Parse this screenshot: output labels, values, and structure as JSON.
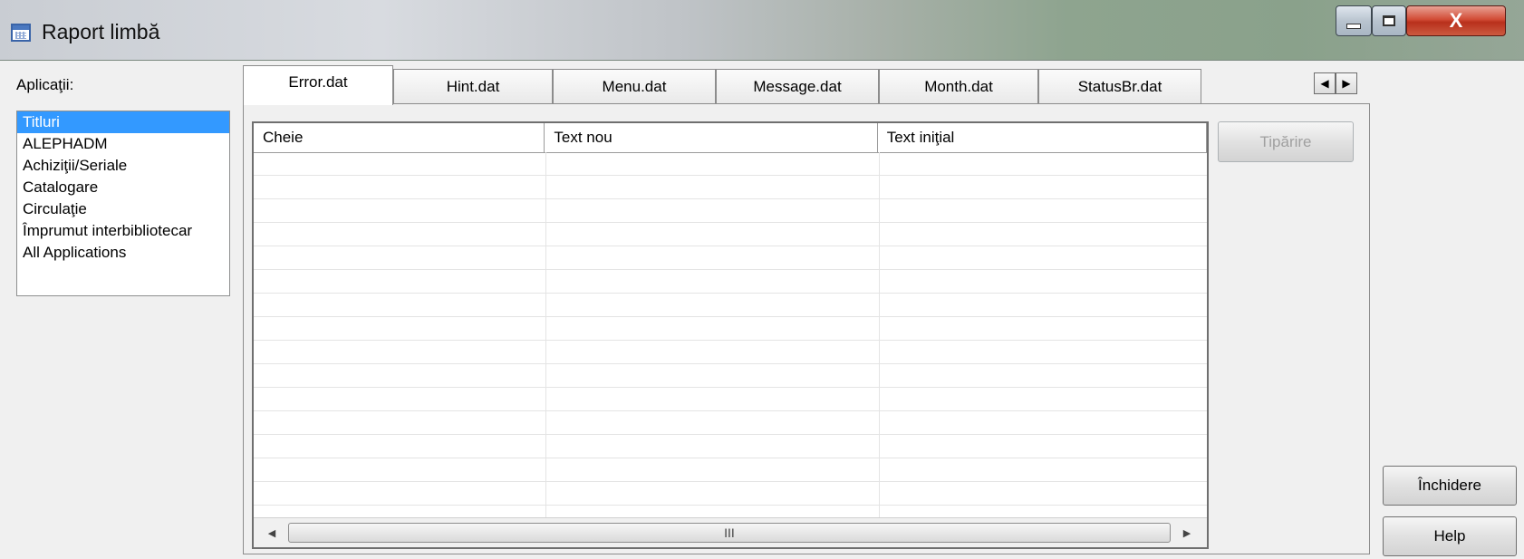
{
  "window": {
    "title": "Raport limbă",
    "close_glyph": "X"
  },
  "apps": {
    "label": "Aplicaţii:",
    "items": [
      {
        "label": "Titluri",
        "selected": true
      },
      {
        "label": "ALEPHADM"
      },
      {
        "label": "Achiziţii/Seriale"
      },
      {
        "label": "Catalogare"
      },
      {
        "label": "Circulaţie"
      },
      {
        "label": "Împrumut interbibliotecar"
      },
      {
        "label": "All Applications"
      }
    ]
  },
  "tabs": [
    {
      "label": "Error.dat",
      "active": true
    },
    {
      "label": "Hint.dat"
    },
    {
      "label": "Menu.dat"
    },
    {
      "label": "Message.dat"
    },
    {
      "label": "Month.dat"
    },
    {
      "label": "StatusBr.dat"
    }
  ],
  "tab_scroll": {
    "left": "◀",
    "right": "▶"
  },
  "grid": {
    "columns": [
      "Cheie",
      "Text nou",
      "Text iniţial"
    ],
    "rows": [],
    "scroll_left": "◀",
    "scroll_right": "▶",
    "thumb_grip": "III"
  },
  "buttons": {
    "print": "Tipărire",
    "close": "Închidere",
    "help": "Help"
  }
}
